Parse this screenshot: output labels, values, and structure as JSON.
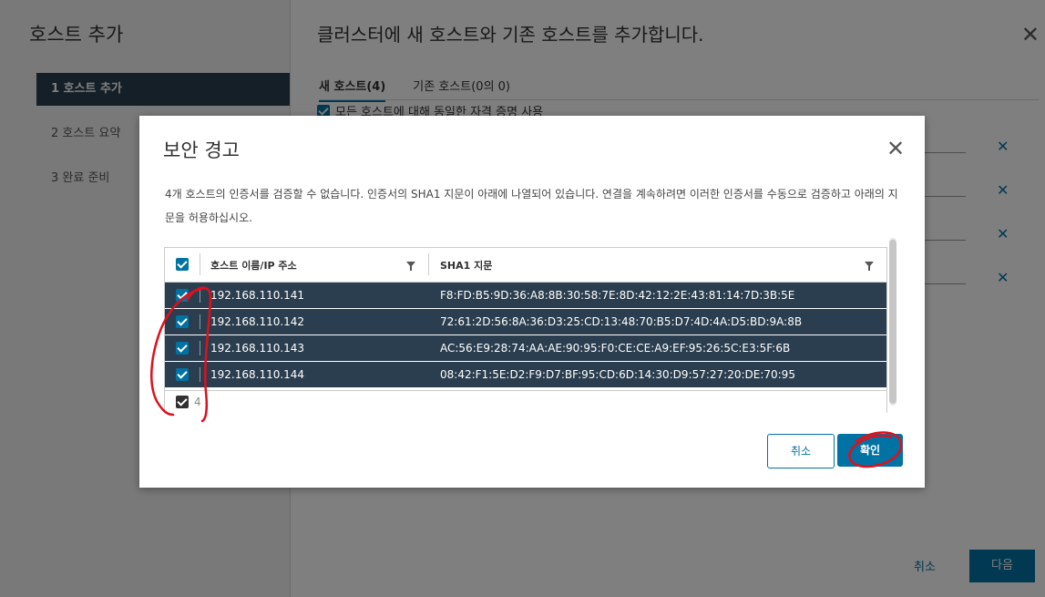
{
  "wizard": {
    "left_title": "호스트 추가",
    "steps": [
      {
        "label": "1  호스트 추가"
      },
      {
        "label": "2  호스트 요약"
      },
      {
        "label": "3  완료 준비"
      }
    ],
    "title": "클러스터에 새 호스트와 기존 호스트를 추가합니다.",
    "tabs": [
      {
        "label": "새 호스트(4)"
      },
      {
        "label": "기존 호스트(0의 0)"
      }
    ],
    "same_credentials": "모든 호스트에 대해 동일한 자격 증명 사용",
    "cancel_label": "취소",
    "next_label": "다음"
  },
  "dialog": {
    "title": "보안 경고",
    "message": "4개 호스트의 인증서를 검증할 수 없습니다. 인증서의 SHA1 지문이 아래에 나열되어 있습니다. 연결을 계속하려면 이러한 인증서를 수동으로 검증하고 아래의 지문을 허용하십시오.",
    "columns": {
      "host": "호스트 이름/IP 주소",
      "sha1": "SHA1 지문"
    },
    "rows": [
      {
        "ip": "192.168.110.141",
        "sha1": "F8:FD:B5:9D:36:A8:8B:30:58:7E:8D:42:12:2E:43:81:14:7D:3B:5E"
      },
      {
        "ip": "192.168.110.142",
        "sha1": "72:61:2D:56:8A:36:D3:25:CD:13:48:70:B5:D7:4D:4A:D5:BD:9A:8B"
      },
      {
        "ip": "192.168.110.143",
        "sha1": "AC:56:E9:28:74:AA:AE:90:95:F0:CE:CE:A9:EF:95:26:5C:E3:5F:6B"
      },
      {
        "ip": "192.168.110.144",
        "sha1": "08:42:F1:5E:D2:F9:D7:BF:95:CD:6D:14:30:D9:57:27:20:DE:70:95"
      }
    ],
    "footer_count": "4",
    "cancel_label": "취소",
    "ok_label": "확인"
  },
  "colors": {
    "accent": "#0072a3",
    "selected_row": "#2b3e4f",
    "annotation": "#e0101b"
  },
  "icons": [
    "close-icon",
    "filter-icon",
    "checkbox-checked-icon"
  ]
}
